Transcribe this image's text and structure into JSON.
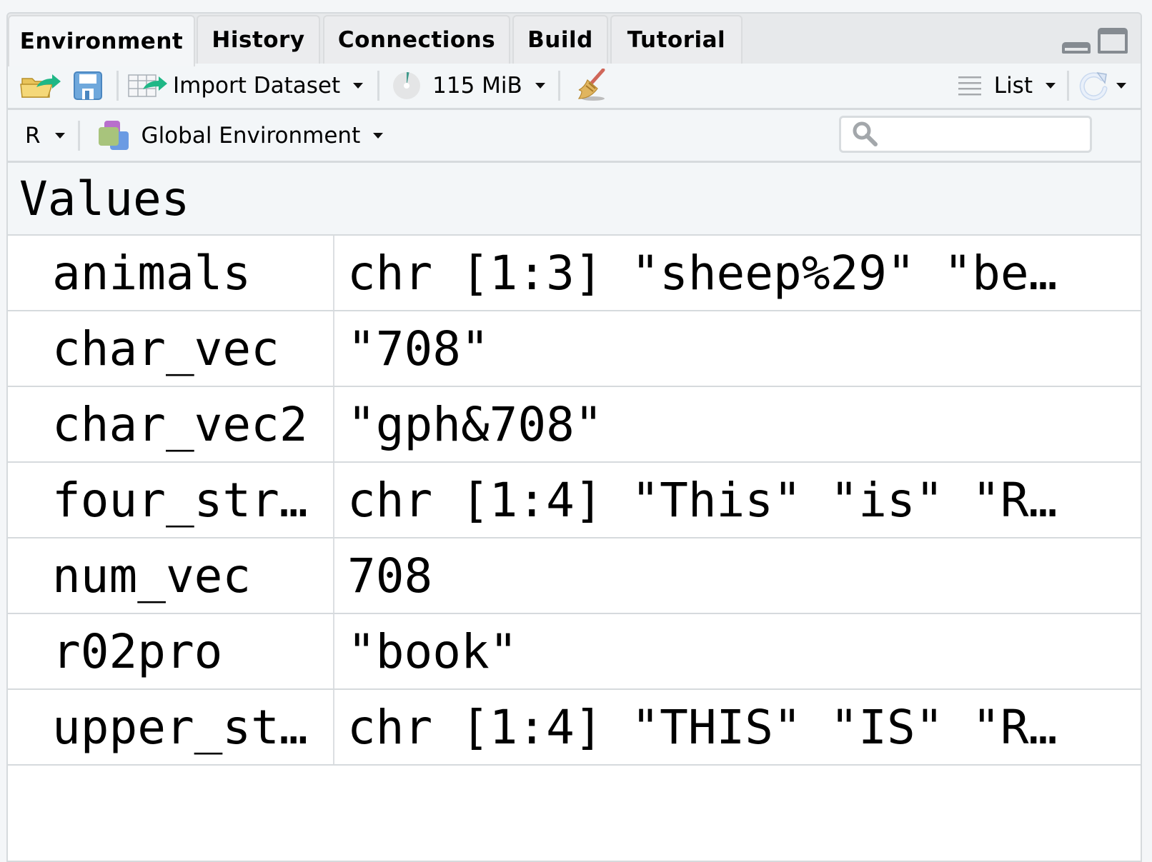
{
  "tabs": [
    {
      "label": "Environment",
      "active": true
    },
    {
      "label": "History",
      "active": false
    },
    {
      "label": "Connections",
      "active": false
    },
    {
      "label": "Build",
      "active": false
    },
    {
      "label": "Tutorial",
      "active": false
    }
  ],
  "window_controls": {
    "minimize_icon": "minimize-pane-icon",
    "maximize_icon": "maximize-pane-icon"
  },
  "toolbar": {
    "load_icon": "open-folder-icon",
    "save_icon": "save-disk-icon",
    "import_dataset_label": "Import Dataset",
    "memory_label": "115 MiB",
    "memory_usage_fraction": 0.03,
    "clear_icon": "broom-icon",
    "view_mode_label": "List",
    "refresh_icon": "refresh-icon"
  },
  "env_bar": {
    "language_label": "R",
    "environment_label": "Global Environment",
    "search_placeholder": "",
    "search_value": ""
  },
  "section": {
    "title": "Values"
  },
  "rows": [
    {
      "name": "animals",
      "value": "chr [1:3] \"sheep%29\" \"be…"
    },
    {
      "name": "char_vec",
      "value": "\"708\""
    },
    {
      "name": "char_vec2",
      "value": "\"gph&708\""
    },
    {
      "name": "four_str…",
      "value": "chr [1:4] \"This\" \"is\" \"R…"
    },
    {
      "name": "num_vec",
      "value": "708"
    },
    {
      "name": "r02pro",
      "value": "\"book\""
    },
    {
      "name": "upper_st…",
      "value": "chr [1:4] \"THIS\" \"IS\" \"R…"
    }
  ],
  "colors": {
    "accent_green": "#1fb786",
    "memory_slice": "#3f9a8c"
  }
}
